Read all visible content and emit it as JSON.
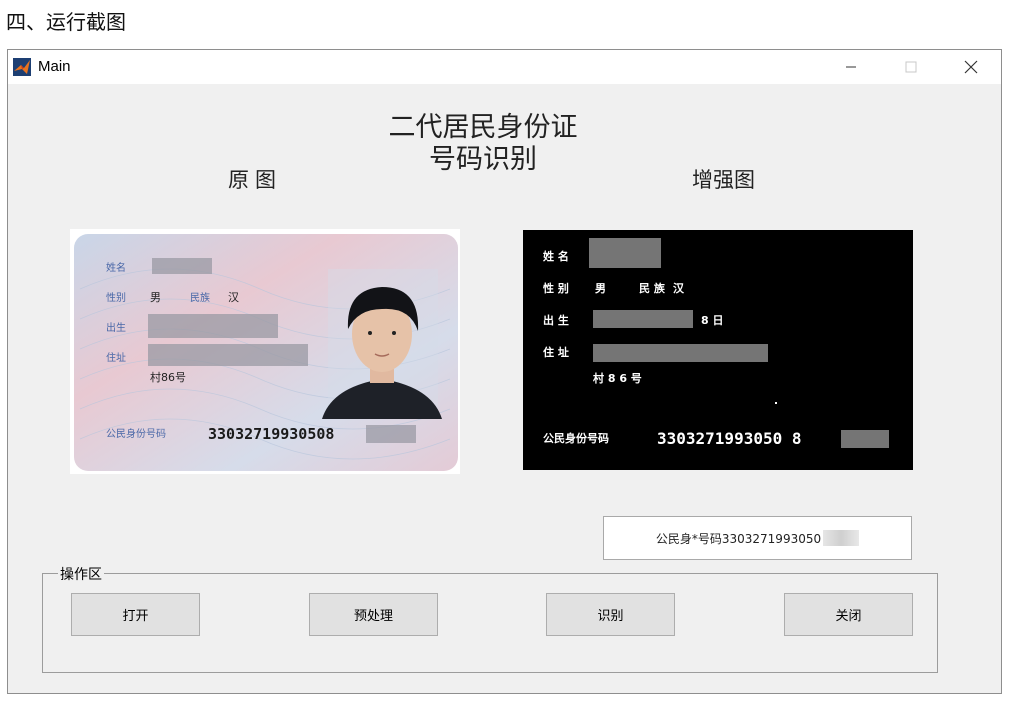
{
  "page_heading": "四、运行截图",
  "window": {
    "title": "Main",
    "controls": {
      "minimize": "—",
      "maximize": "☐",
      "close": "✕"
    }
  },
  "main_title_line1": "二代居民身份证",
  "main_title_line2": "号码识别",
  "original_label": "原图",
  "enhanced_label": "增强图",
  "id_card": {
    "name_label": "姓名",
    "gender_label": "性别",
    "gender_value": "男",
    "ethnicity_label": "民族",
    "ethnicity_value": "汉",
    "birth_label": "出生",
    "address_label": "住址",
    "address_tail": "村86号",
    "id_label": "公民身份号码",
    "id_number": "33032719930508"
  },
  "enhanced_card": {
    "name_label": "姓 名",
    "gender_label": "性 别",
    "gender_value": "男",
    "ethnicity_label": "民 族",
    "ethnicity_value": "汉",
    "birth_label": "出 生",
    "birth_tail": "8 日",
    "address_label": "住 址",
    "address_tail": "村 8 6 号",
    "id_label": "公民身份号码",
    "id_number": "3303271993050 8"
  },
  "result_text": "公民身*号码3303271993050",
  "operation_group_label": "操作区",
  "buttons": {
    "open": "打开",
    "preprocess": "预处理",
    "recognize": "识别",
    "close": "关闭"
  },
  "colors": {
    "window_bg": "#f0f0f0",
    "button_bg": "#e1e1e1",
    "enhanced_bg": "#000000"
  }
}
